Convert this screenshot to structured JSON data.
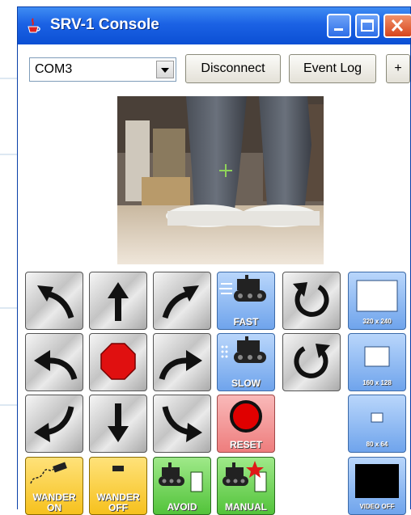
{
  "window": {
    "title": "SRV-1 Console"
  },
  "toolbar": {
    "port_value": "COM3",
    "disconnect_label": "Disconnect",
    "event_log_label": "Event Log",
    "plus_label": "+"
  },
  "controls": {
    "fast_label": "FAST",
    "slow_label": "SLOW",
    "reset_label": "RESET",
    "res_320_label": "320 x 240",
    "res_160_label": "160 x 128",
    "res_80_label": "80 x 64",
    "video_off_label": "VIDEO OFF",
    "wander_on_line1": "WANDER",
    "wander_on_line2": "ON",
    "wander_off_line1": "WANDER",
    "wander_off_line2": "OFF",
    "avoid_label": "AVOID",
    "manual_label": "MANUAL"
  },
  "colors": {
    "titlebar": "#1b62e4",
    "stop": "#e01010",
    "blue_button": "#6fa4ec",
    "red_button": "#ee7d7d",
    "yellow_button": "#f6c11d",
    "green_button": "#52c33a"
  }
}
